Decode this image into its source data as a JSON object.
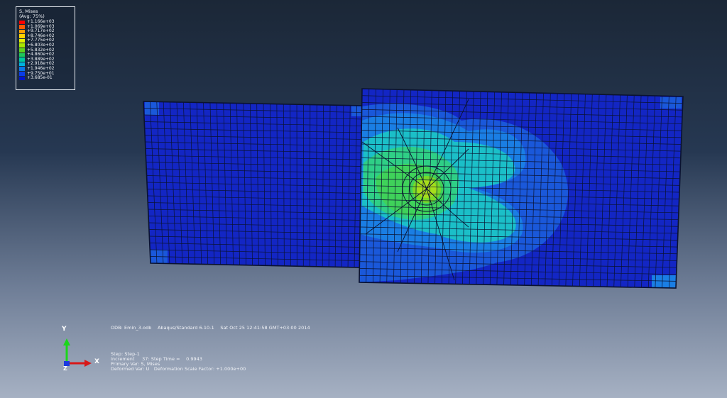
{
  "legend": {
    "title_line1": "S, Mises",
    "title_line2": "(Avg: 75%)",
    "entries": [
      {
        "value": "+1.166e+03",
        "color": "#ff0000"
      },
      {
        "value": "+1.069e+03",
        "color": "#ff5a00"
      },
      {
        "value": "+9.717e+02",
        "color": "#ffa000"
      },
      {
        "value": "+8.746e+02",
        "color": "#ffd200"
      },
      {
        "value": "+7.775e+02",
        "color": "#e6f000"
      },
      {
        "value": "+6.803e+02",
        "color": "#a8e600"
      },
      {
        "value": "+5.832e+02",
        "color": "#5fd21e"
      },
      {
        "value": "+4.860e+02",
        "color": "#1ec85a"
      },
      {
        "value": "+3.889e+02",
        "color": "#00c8a0"
      },
      {
        "value": "+2.918e+02",
        "color": "#00b4dc"
      },
      {
        "value": "+1.946e+02",
        "color": "#0a78e6"
      },
      {
        "value": "+9.750e+01",
        "color": "#0a3ce6"
      },
      {
        "value": "+3.685e-01",
        "color": "#0014c8"
      }
    ]
  },
  "info": {
    "odb_line": "ODB: Emin_3.odb    Abaqus/Standard 6.10-1    Sat Oct 25 12:41:58 GMT+03:00 2014",
    "step_line": "Step: Step-1",
    "increment_line": "Increment     37: Step Time =    0.9943",
    "primary_var_line": "Primary Var: S, Mises",
    "deformed_var_line": "Deformed Var: U   Deformation Scale Factor: +1.000e+00"
  },
  "triad": {
    "y": "Y",
    "x": "X",
    "z": "Z"
  },
  "colors": {
    "mesh_line": "#0a1230",
    "part_base": "#1326c4",
    "contour_mid": "#1a6fe0",
    "contour_cyan": "#1bbfc8",
    "contour_green": "#2fcf86",
    "contour_lime": "#7ad928",
    "contour_yellow": "#b7e21a"
  }
}
